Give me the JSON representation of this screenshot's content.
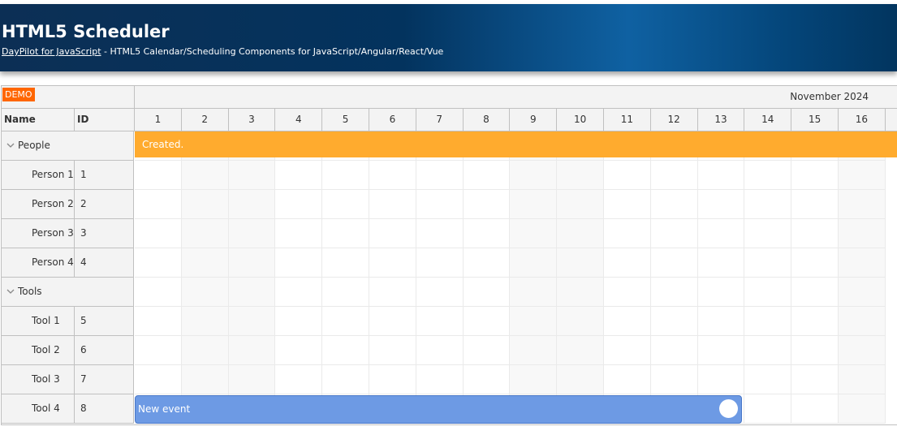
{
  "header": {
    "title": "HTML5 Scheduler",
    "link_text": "DayPilot for JavaScript",
    "subtitle_rest": " - HTML5 Calendar/Scheduling Components for JavaScript/Angular/React/Vue"
  },
  "scheduler": {
    "demo_badge": "DEMO",
    "month_label": "November 2024",
    "columns": {
      "name": "Name",
      "id": "ID"
    },
    "days": [
      "1",
      "2",
      "3",
      "4",
      "5",
      "6",
      "7",
      "8",
      "9",
      "10",
      "11",
      "12",
      "13",
      "14",
      "15",
      "16"
    ],
    "rows": [
      {
        "type": "group",
        "name": "People",
        "id": ""
      },
      {
        "type": "child",
        "name": "Person 1",
        "id": "1"
      },
      {
        "type": "child",
        "name": "Person 2",
        "id": "2"
      },
      {
        "type": "child",
        "name": "Person 3",
        "id": "3"
      },
      {
        "type": "child",
        "name": "Person 4",
        "id": "4"
      },
      {
        "type": "group",
        "name": "Tools",
        "id": ""
      },
      {
        "type": "child",
        "name": "Tool 1",
        "id": "5"
      },
      {
        "type": "child",
        "name": "Tool 2",
        "id": "6"
      },
      {
        "type": "child",
        "name": "Tool 3",
        "id": "7"
      },
      {
        "type": "child",
        "name": "Tool 4",
        "id": "8"
      }
    ],
    "events": {
      "group_event_text": "Created.",
      "new_event_text": "New event"
    }
  },
  "colors": {
    "header_dark": "#02355f",
    "header_light": "#0f61a2",
    "demo_badge": "#ff6600",
    "group_event": "#ffab2e",
    "new_event": "#6d9ae4"
  }
}
